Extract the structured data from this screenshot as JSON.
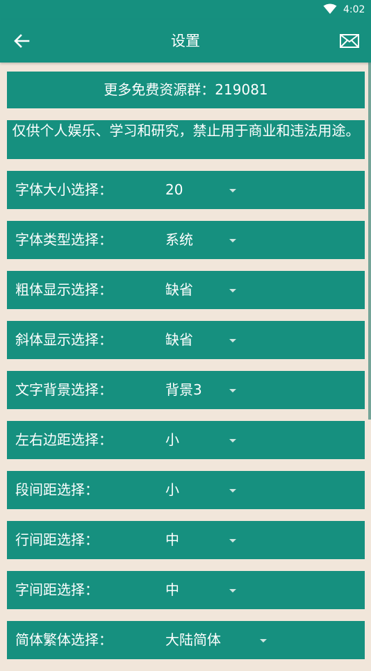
{
  "status_bar": {
    "time": "4:02"
  },
  "app_bar": {
    "title": "设置"
  },
  "banners": {
    "groups": "更多免费资源群：219081",
    "notice": "仅供个人娱乐、学习和研究，禁止用于商业和违法用途。"
  },
  "settings": [
    {
      "label": "字体大小选择：",
      "value": "20"
    },
    {
      "label": "字体类型选择：",
      "value": "系统"
    },
    {
      "label": "粗体显示选择：",
      "value": "缺省"
    },
    {
      "label": "斜体显示选择：",
      "value": "缺省"
    },
    {
      "label": "文字背景选择：",
      "value": "背景3"
    },
    {
      "label": "左右边距选择：",
      "value": "小"
    },
    {
      "label": "段间距选择：",
      "value": "小"
    },
    {
      "label": "行间距选择：",
      "value": "中"
    },
    {
      "label": "字间距选择：",
      "value": "中"
    },
    {
      "label": "简体繁体选择：",
      "value": "大陆简体"
    }
  ],
  "colors": {
    "primary": "#16907f",
    "background": "#f1e6da",
    "text": "#ffffff"
  },
  "icons": {
    "back": "arrow-left-icon",
    "mail": "mail-icon",
    "wifi": "wifi-icon",
    "dropdown": "caret-down-icon"
  }
}
